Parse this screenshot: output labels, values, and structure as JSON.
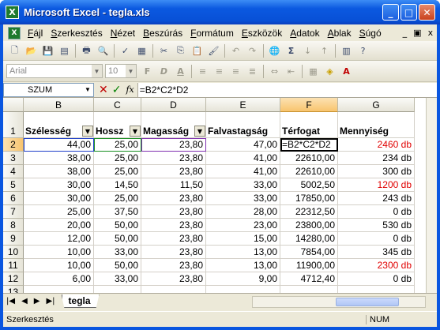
{
  "window": {
    "title": "Microsoft Excel - tegla.xls"
  },
  "menubar": {
    "items": [
      "Fájl",
      "Szerkesztés",
      "Nézet",
      "Beszúrás",
      "Formátum",
      "Eszközök",
      "Adatok",
      "Ablak",
      "Súgó"
    ],
    "controls": [
      "_",
      "x"
    ]
  },
  "formatting": {
    "font": "Arial",
    "size": "10"
  },
  "formula_bar": {
    "name_box": "SZUM",
    "formula": "=B2*C2*D2"
  },
  "columns": [
    "B",
    "C",
    "D",
    "E",
    "F",
    "G"
  ],
  "header_row": {
    "row": "1",
    "cells": [
      "Szélesség",
      "Hossz",
      "Magasság",
      "Falvastagság",
      "Térfogat",
      "Mennyiség"
    ]
  },
  "rows": [
    {
      "row": "2",
      "b": "44,00",
      "c": "25,00",
      "d": "23,80",
      "e": "47,00",
      "f": "=B2*C2*D2",
      "g": "2460 db",
      "g_red": true
    },
    {
      "row": "3",
      "b": "38,00",
      "c": "25,00",
      "d": "23,80",
      "e": "41,00",
      "f": "22610,00",
      "g": "234 db",
      "g_red": false
    },
    {
      "row": "4",
      "b": "38,00",
      "c": "25,00",
      "d": "23,80",
      "e": "41,00",
      "f": "22610,00",
      "g": "300 db",
      "g_red": false
    },
    {
      "row": "5",
      "b": "30,00",
      "c": "14,50",
      "d": "11,50",
      "e": "33,00",
      "f": "5002,50",
      "g": "1200 db",
      "g_red": true
    },
    {
      "row": "6",
      "b": "30,00",
      "c": "25,00",
      "d": "23,80",
      "e": "33,00",
      "f": "17850,00",
      "g": "243 db",
      "g_red": false
    },
    {
      "row": "7",
      "b": "25,00",
      "c": "37,50",
      "d": "23,80",
      "e": "28,00",
      "f": "22312,50",
      "g": "0 db",
      "g_red": false
    },
    {
      "row": "8",
      "b": "20,00",
      "c": "50,00",
      "d": "23,80",
      "e": "23,00",
      "f": "23800,00",
      "g": "530 db",
      "g_red": false
    },
    {
      "row": "9",
      "b": "12,00",
      "c": "50,00",
      "d": "23,80",
      "e": "15,00",
      "f": "14280,00",
      "g": "0 db",
      "g_red": false
    },
    {
      "row": "10",
      "b": "10,00",
      "c": "33,00",
      "d": "23,80",
      "e": "13,00",
      "f": "7854,00",
      "g": "345 db",
      "g_red": false
    },
    {
      "row": "11",
      "b": "10,00",
      "c": "50,00",
      "d": "23,80",
      "e": "13,00",
      "f": "11900,00",
      "g": "2300 db",
      "g_red": true
    },
    {
      "row": "12",
      "b": "6,00",
      "c": "33,00",
      "d": "23,80",
      "e": "9,00",
      "f": "4712,40",
      "g": "0 db",
      "g_red": false
    },
    {
      "row": "13",
      "b": "",
      "c": "",
      "d": "",
      "e": "",
      "f": "",
      "g": "",
      "g_red": false
    }
  ],
  "sheet_tab": "tegla",
  "status": {
    "mode": "Szerkesztés",
    "num": "NUM"
  }
}
